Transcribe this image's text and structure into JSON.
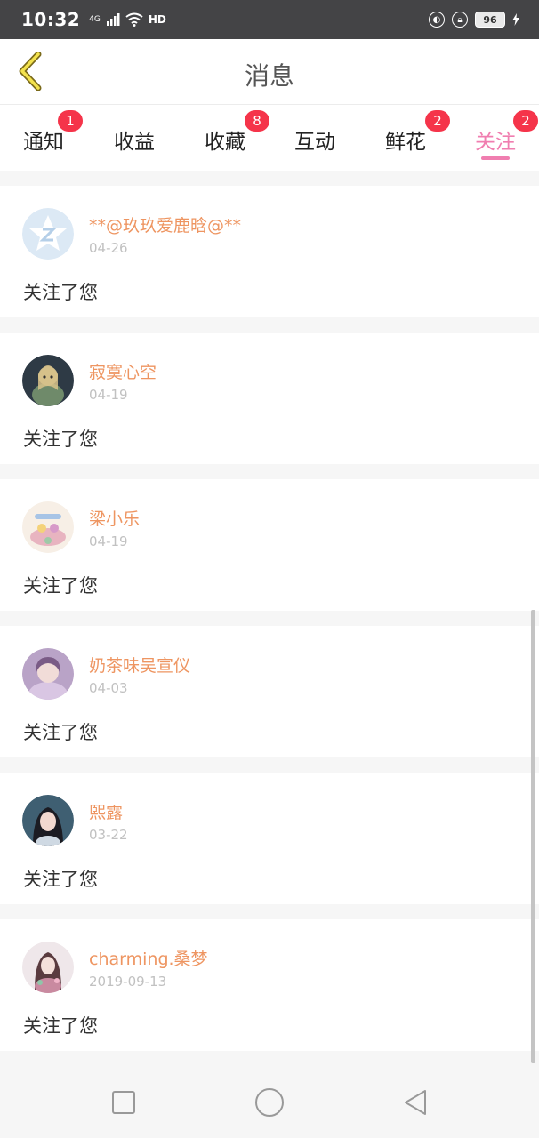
{
  "status_bar": {
    "time": "10:32",
    "network": "4G",
    "hd": "HD",
    "battery": "96"
  },
  "header": {
    "title": "消息"
  },
  "tabs": [
    {
      "label": "通知",
      "badge": "1"
    },
    {
      "label": "收益",
      "badge": ""
    },
    {
      "label": "收藏",
      "badge": "8"
    },
    {
      "label": "互动",
      "badge": ""
    },
    {
      "label": "鲜花",
      "badge": "2"
    },
    {
      "label": "关注",
      "badge": "2",
      "active": true
    }
  ],
  "messages": [
    {
      "name": "**@玖玖爱鹿晗@**",
      "date": "04-26",
      "action": "关注了您"
    },
    {
      "name": "寂寞心空",
      "date": "04-19",
      "action": "关注了您"
    },
    {
      "name": "梁小乐",
      "date": "04-19",
      "action": "关注了您"
    },
    {
      "name": "奶茶味吴宣仪",
      "date": "04-03",
      "action": "关注了您"
    },
    {
      "name": "熙露",
      "date": "03-22",
      "action": "关注了您"
    },
    {
      "name": "charming.桑梦",
      "date": "2019-09-13",
      "action": "关注了您"
    }
  ],
  "colors": {
    "accent": "#f07eb0",
    "badge": "#f5344a",
    "username": "#ee9561"
  }
}
